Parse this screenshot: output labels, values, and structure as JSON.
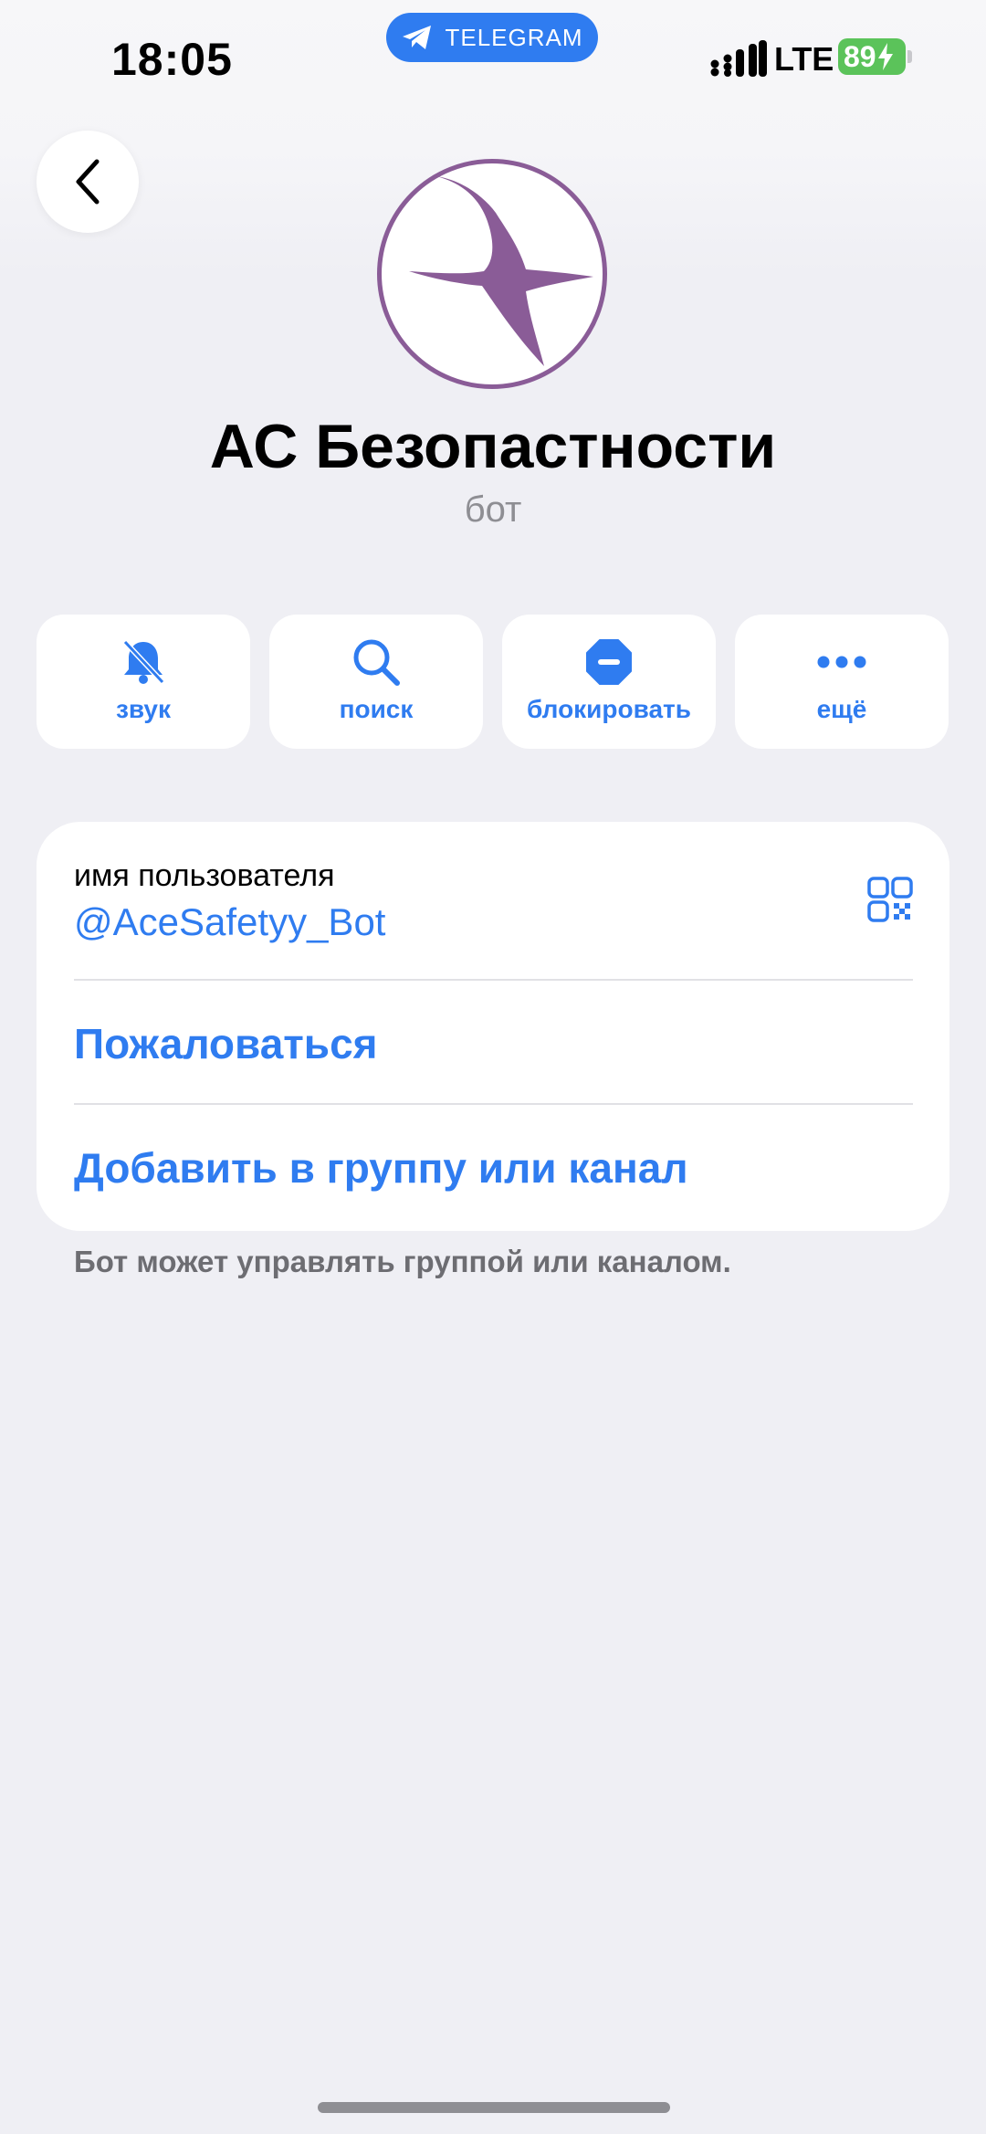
{
  "status_bar": {
    "time": "18:05",
    "app_pill": "TELEGRAM",
    "network": "LTE",
    "battery": "89"
  },
  "profile": {
    "name": "АС Безопастности",
    "subtitle": "бот"
  },
  "actions": [
    {
      "label": "звук",
      "icon": "bell-slash-icon"
    },
    {
      "label": "поиск",
      "icon": "search-icon"
    },
    {
      "label": "блокировать",
      "icon": "block-icon"
    },
    {
      "label": "ещё",
      "icon": "more-icon"
    }
  ],
  "info": {
    "username_label": "имя пользователя",
    "username": "@AceSafetyy_Bot",
    "report": "Пожаловаться",
    "add_to_group": "Добавить в группу или канал",
    "footnote": "Бот может управлять группой или каналом."
  },
  "colors": {
    "accent": "#2f7cf0",
    "background": "#efeff4",
    "avatar_purple": "#8a5c97"
  }
}
